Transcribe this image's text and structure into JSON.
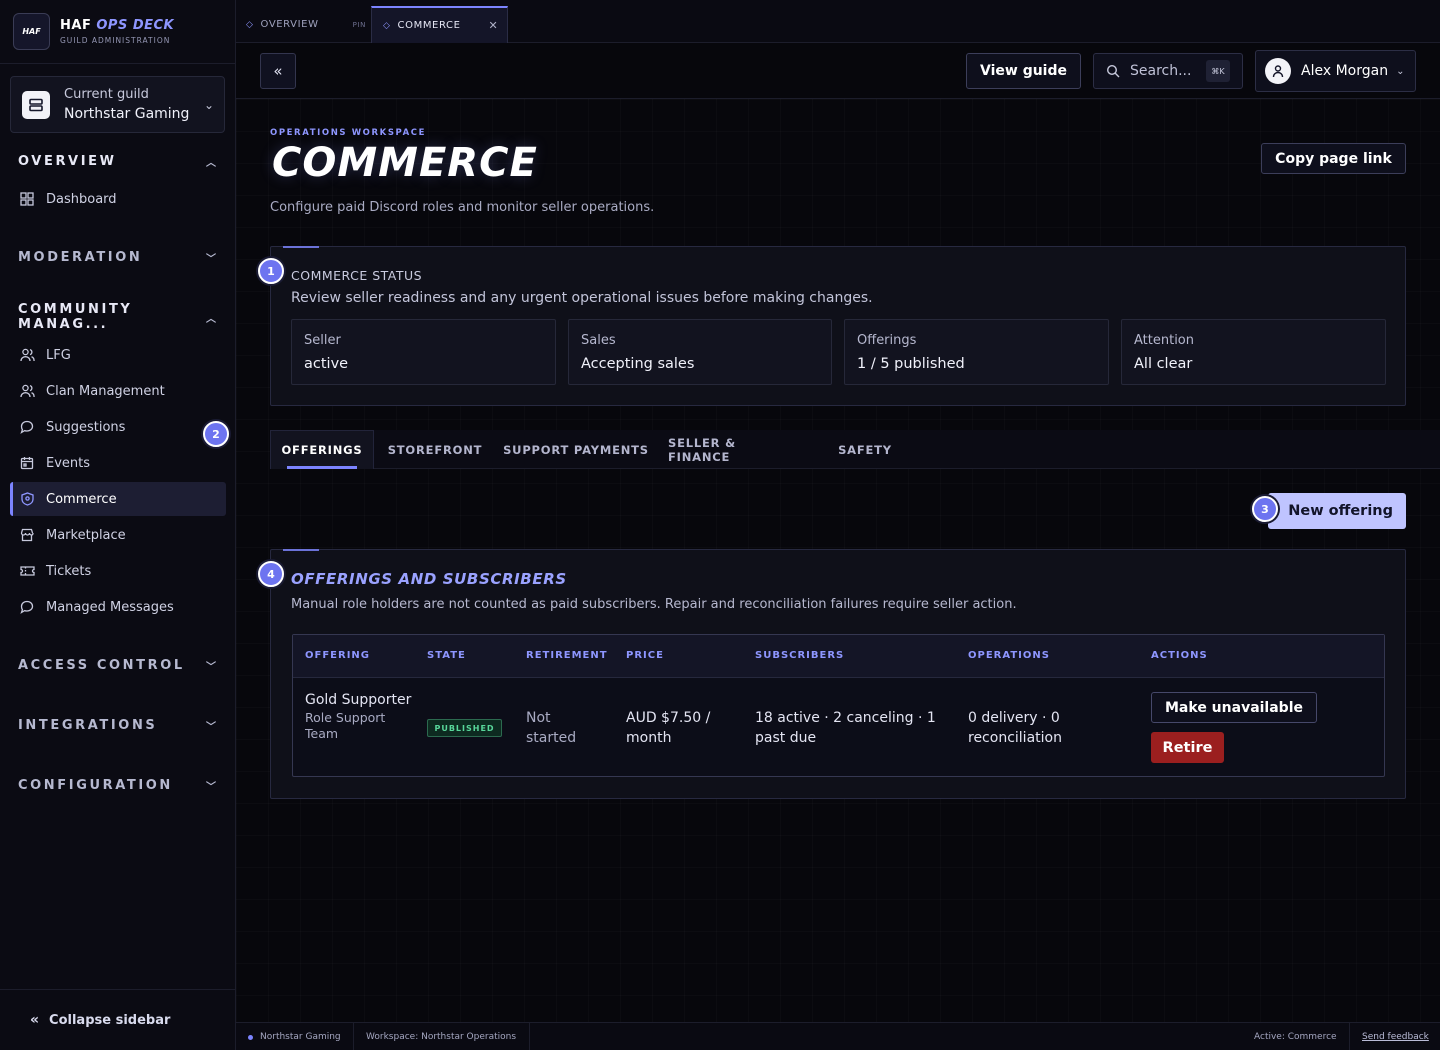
{
  "brand": {
    "logo": "HAF",
    "title": "HAF",
    "title_accent": "OPS DECK",
    "subtitle": "GUILD ADMINISTRATION"
  },
  "guild": {
    "label": "Current guild",
    "name": "Northstar Gaming"
  },
  "nav": {
    "overview": "OVERVIEW",
    "dashboard": "Dashboard",
    "moderation": "MODERATION",
    "community": "COMMUNITY MANAG...",
    "items": [
      "LFG",
      "Clan Management",
      "Suggestions",
      "Events",
      "Commerce",
      "Marketplace",
      "Tickets",
      "Managed Messages"
    ],
    "access_control": "ACCESS CONTROL",
    "integrations": "INTEGRATIONS",
    "configuration": "CONFIGURATION",
    "collapse": "Collapse sidebar"
  },
  "tabs": {
    "overview": "OVERVIEW",
    "pin": "PIN",
    "commerce": "COMMERCE"
  },
  "header": {
    "view_guide": "View guide",
    "search_placeholder": "Search...",
    "search_kbd": "⌘K",
    "user_name": "Alex Morgan"
  },
  "page": {
    "eyebrow": "OPERATIONS WORKSPACE",
    "title": "COMMERCE",
    "description": "Configure paid Discord roles and monitor seller operations.",
    "copy_link": "Copy page link"
  },
  "guide_steps": [
    "1",
    "2",
    "3",
    "4"
  ],
  "status": {
    "label": "COMMERCE STATUS",
    "description": "Review seller readiness and any urgent operational issues before making changes.",
    "cards": [
      {
        "label": "Seller",
        "value": "active"
      },
      {
        "label": "Sales",
        "value": "Accepting sales"
      },
      {
        "label": "Offerings",
        "value": "1 / 5 published"
      },
      {
        "label": "Attention",
        "value": "All clear"
      }
    ]
  },
  "section_tabs": [
    "OFFERINGS",
    "STOREFRONT",
    "SUPPORT PAYMENTS",
    "SELLER & FINANCE",
    "SAFETY"
  ],
  "new_offering": "New offering",
  "offerings": {
    "title": "OFFERINGS AND SUBSCRIBERS",
    "description": "Manual role holders are not counted as paid subscribers. Repair and reconciliation failures require seller action.",
    "columns": [
      "OFFERING",
      "STATE",
      "RETIREMENT",
      "PRICE",
      "SUBSCRIBERS",
      "OPERATIONS",
      "ACTIONS"
    ],
    "rows": [
      {
        "name": "Gold Supporter",
        "role": "Role Support Team",
        "state": "PUBLISHED",
        "retirement": "Not started",
        "price": "AUD $7.50 / month",
        "subscribers": "18 active · 2 canceling · 1 past due",
        "operations": "0 delivery · 0 reconciliation",
        "action_primary": "Make unavailable",
        "action_danger": "Retire"
      }
    ]
  },
  "footer": {
    "guild": "Northstar Gaming",
    "workspace": "Workspace: Northstar Operations",
    "active": "Active: Commerce",
    "feedback": "Send feedback"
  },
  "colors": {
    "accent": "#7c84ff",
    "success": "#58d69a",
    "danger": "#9b1f1f",
    "background": "#07070c"
  }
}
